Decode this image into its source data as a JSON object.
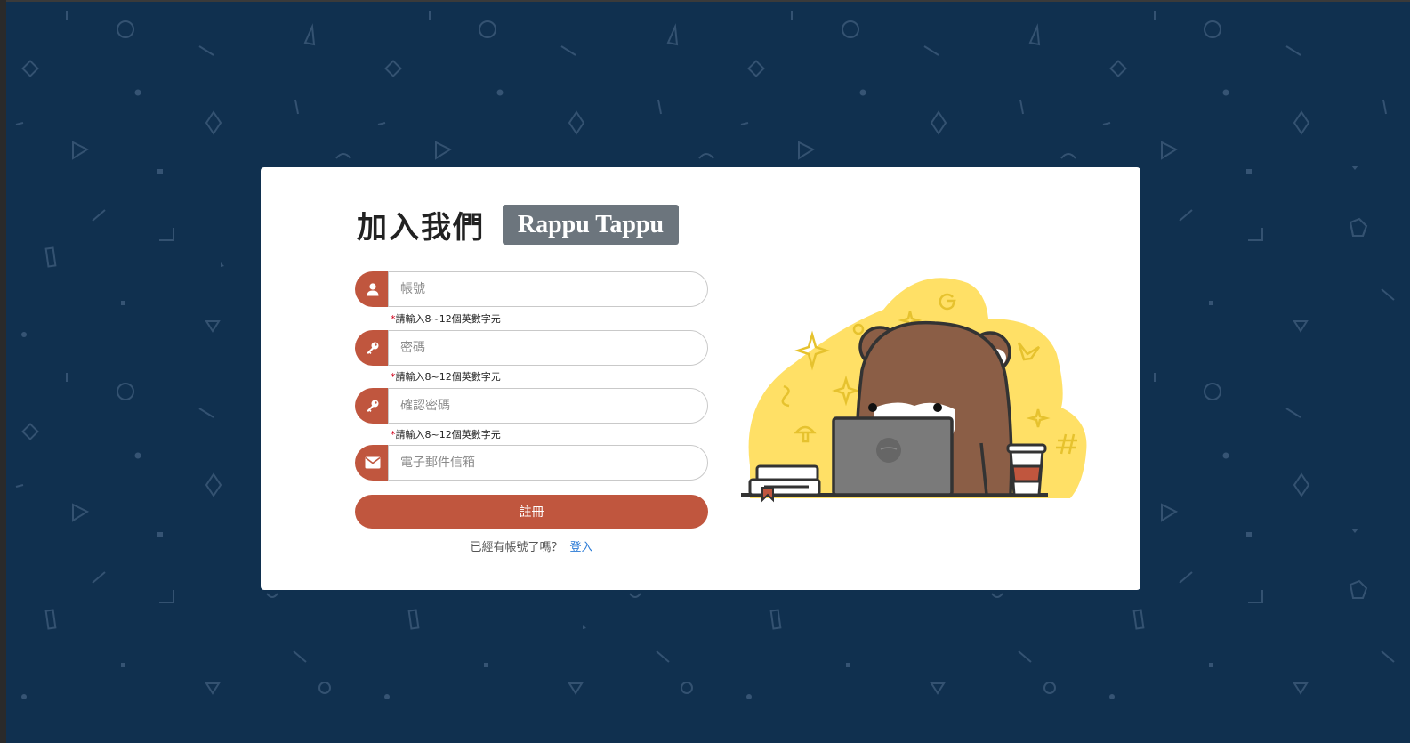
{
  "form": {
    "title": "加入我們",
    "brand": "Rappu Tappu",
    "fields": [
      {
        "placeholder": "帳號",
        "value": "",
        "icon": "user-icon",
        "hint": "請輸入8~12個英數字元"
      },
      {
        "placeholder": "密碼",
        "value": "",
        "icon": "key-icon",
        "hint": "請輸入8~12個英數字元"
      },
      {
        "placeholder": "確認密碼",
        "value": "",
        "icon": "key-icon",
        "hint": "請輸入8~12個英數字元"
      },
      {
        "placeholder": "電子郵件信箱",
        "value": "",
        "icon": "envelope-icon"
      }
    ],
    "hint_marker": "*",
    "submit_label": "註冊",
    "login_prompt": "已經有帳號了嗎？",
    "login_link": "登入"
  },
  "colors": {
    "background": "#10304f",
    "accent": "#c0563e",
    "badge": "#6c757d",
    "illustration_yellow": "#ffe066",
    "bear_brown": "#8b5e46",
    "link": "#2b7bd6"
  }
}
